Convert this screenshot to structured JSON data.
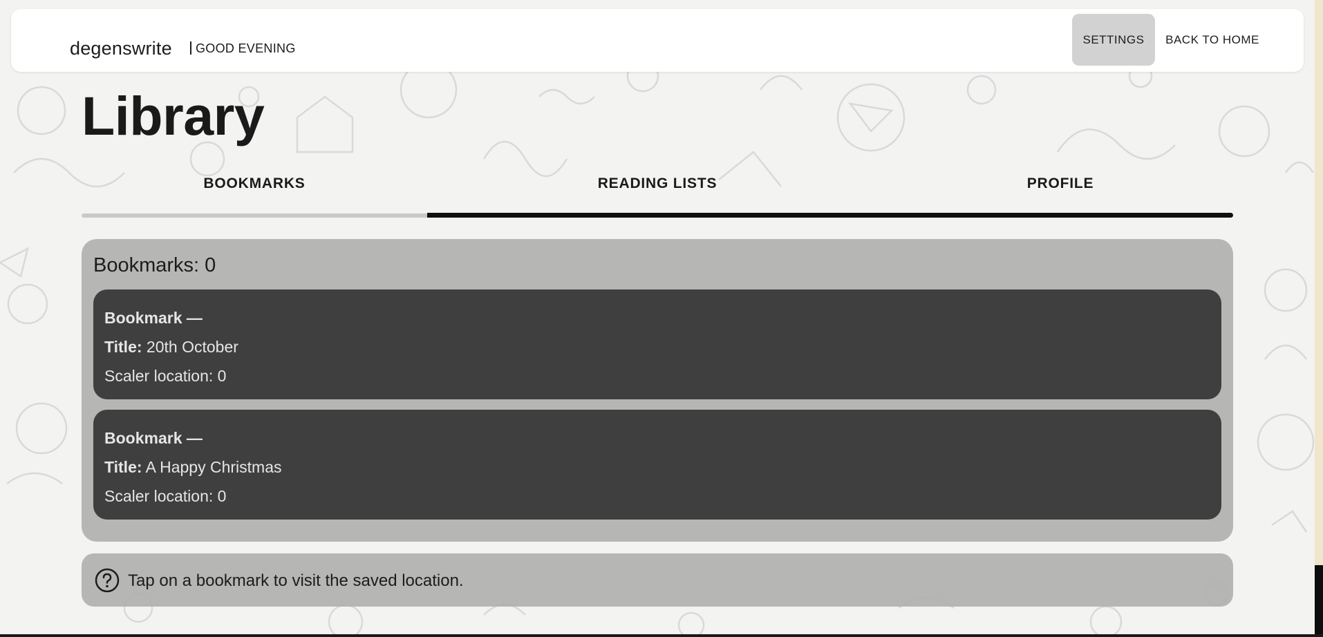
{
  "header": {
    "brand": "degenswrite",
    "greeting": "GOOD EVENING",
    "settings_label": "SETTINGS",
    "home_label": "BACK TO HOME"
  },
  "page": {
    "title": "Library"
  },
  "tabs": [
    {
      "label": "BOOKMARKS",
      "active": false
    },
    {
      "label": "READING LISTS",
      "active": true
    },
    {
      "label": "PROFILE",
      "active": false
    }
  ],
  "bookmarks": {
    "count_text": "Bookmarks: 0",
    "items": [
      {
        "heading": "Bookmark —",
        "title_label": "Title:",
        "title_value": " 20th October",
        "location_text": "Scaler location: 0"
      },
      {
        "heading": "Bookmark —",
        "title_label": "Title:",
        "title_value": " A Happy Christmas",
        "location_text": "Scaler location: 0"
      }
    ]
  },
  "hint": {
    "icon": "question-circle-icon",
    "text": "Tap on a bookmark to visit the saved location."
  },
  "colors": {
    "active_tab_underline": "#111111",
    "inactive_tab_underline": "#c9c9c9",
    "panel_bg": "#b0b0b0",
    "card_bg": "#3a3a3a",
    "settings_bg": "#d2d2d2"
  }
}
